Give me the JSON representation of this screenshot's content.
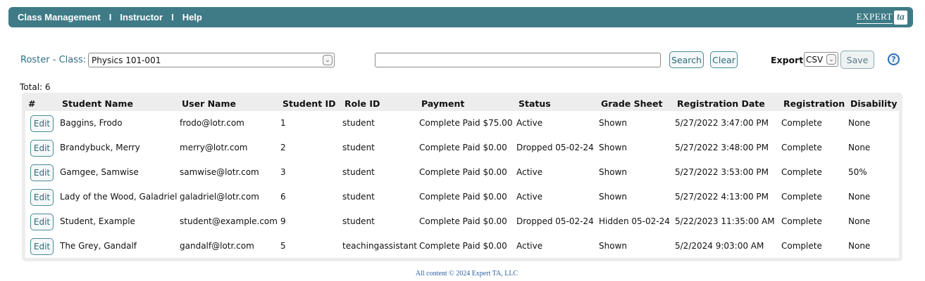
{
  "nav": {
    "items": [
      "Class Management",
      "Instructor",
      "Help"
    ],
    "separator": "I",
    "logo_text": "EXPERT",
    "logo_mark": "ta"
  },
  "controls": {
    "roster_label": "Roster - Class:",
    "class_selected": "Physics 101-001",
    "search_value": "",
    "search_label": "Search",
    "clear_label": "Clear",
    "export_label": "Export:",
    "export_selected": "CSV",
    "save_label": "Save",
    "help_glyph": "?"
  },
  "total_label": "Total: 6",
  "table": {
    "headers": [
      "#",
      "Student Name",
      "User Name",
      "Student ID",
      "Role ID",
      "Payment",
      "Status",
      "Grade Sheet",
      "Registration Date",
      "Registration",
      "Disability"
    ],
    "edit_label": "Edit",
    "rows": [
      [
        "Baggins, Frodo",
        "frodo@lotr.com",
        "1",
        "student",
        "Complete Paid $75.00",
        "Active",
        "Shown",
        "5/27/2022 3:47:00 PM",
        "Complete",
        "None"
      ],
      [
        "Brandybuck, Merry",
        "merry@lotr.com",
        "2",
        "student",
        "Complete Paid $0.00",
        "Dropped 05-02-24",
        "Shown",
        "5/27/2022 3:48:00 PM",
        "Complete",
        "None"
      ],
      [
        "Gamgee, Samwise",
        "samwise@lotr.com",
        "3",
        "student",
        "Complete Paid $0.00",
        "Active",
        "Shown",
        "5/27/2022 3:53:00 PM",
        "Complete",
        "50%"
      ],
      [
        "Lady of the Wood, Galadriel",
        "galadriel@lotr.com",
        "6",
        "student",
        "Complete Paid $0.00",
        "Active",
        "Shown",
        "5/27/2022 4:13:00 PM",
        "Complete",
        "None"
      ],
      [
        "Student, Example",
        "student@example.com",
        "9",
        "student",
        "Complete Paid $0.00",
        "Dropped 05-02-24",
        "Hidden 05-02-24",
        "5/22/2023 11:35:00 AM",
        "Complete",
        "None"
      ],
      [
        "The Grey, Gandalf",
        "gandalf@lotr.com",
        "5",
        "teachingassistant",
        "Complete Paid $0.00",
        "Active",
        "Shown",
        "5/2/2024 9:03:00 AM",
        "Complete",
        "None"
      ]
    ]
  },
  "footer": "All content © 2024 Expert TA, LLC",
  "colors": {
    "topbar": "#3f7b87",
    "label_accent": "#2e6f86",
    "button_border": "#4b8a96",
    "footer_text": "#2b5fa0"
  }
}
